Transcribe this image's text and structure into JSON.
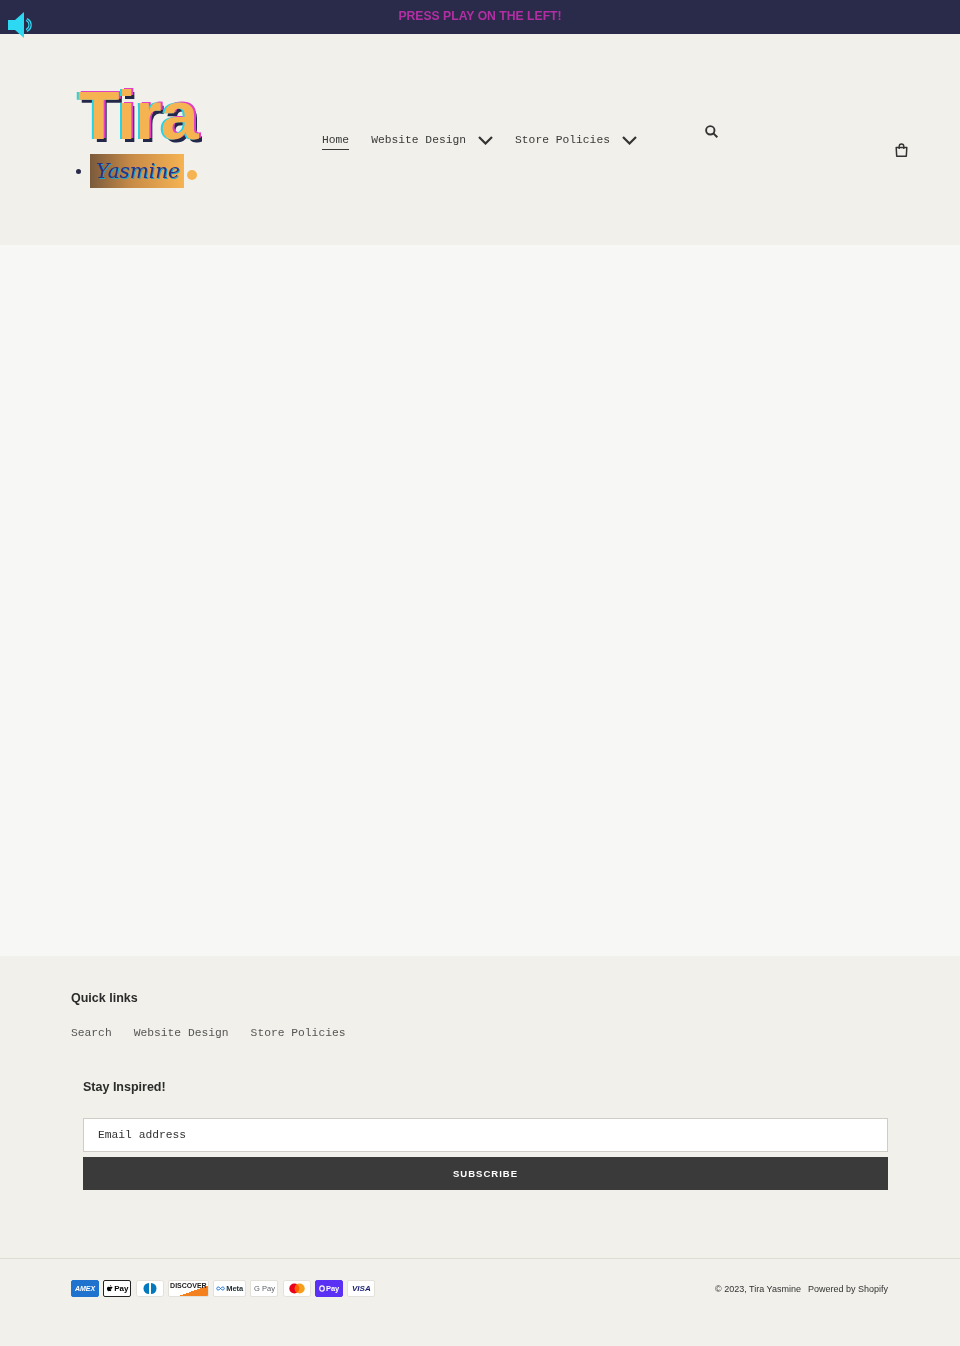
{
  "announcement": {
    "text": "PRESS PLAY ON THE LEFT!"
  },
  "header": {
    "logo": {
      "title": "Tira",
      "script": "Yasmine"
    },
    "nav": [
      {
        "label": "Home",
        "kind": "link",
        "selected": true
      },
      {
        "label": "Website Design",
        "kind": "dropdown",
        "selected": false
      },
      {
        "label": "Store Policies",
        "kind": "dropdown",
        "selected": false
      }
    ]
  },
  "footer": {
    "quick_links": {
      "title": "Quick links",
      "links": [
        "Search",
        "Website Design",
        "Store Policies"
      ]
    },
    "newsletter": {
      "title": "Stay Inspired!",
      "email": {
        "placeholder": "Email address"
      },
      "button": "SUBSCRIBE"
    },
    "payment_methods": [
      {
        "kind": "amex",
        "label": "AMEX"
      },
      {
        "kind": "apple_pay",
        "label": "Pay"
      },
      {
        "kind": "diners"
      },
      {
        "kind": "discover",
        "label": "DISCOVER"
      },
      {
        "kind": "meta_pay",
        "label": "Meta"
      },
      {
        "kind": "google_pay",
        "label": "G Pay"
      },
      {
        "kind": "mastercard"
      },
      {
        "kind": "shop_pay",
        "label": "Pay"
      },
      {
        "kind": "visa",
        "label": "VISA"
      }
    ],
    "copyright": "© 2023, Tira Yasmine",
    "powered_by": "Powered by Shopify"
  }
}
